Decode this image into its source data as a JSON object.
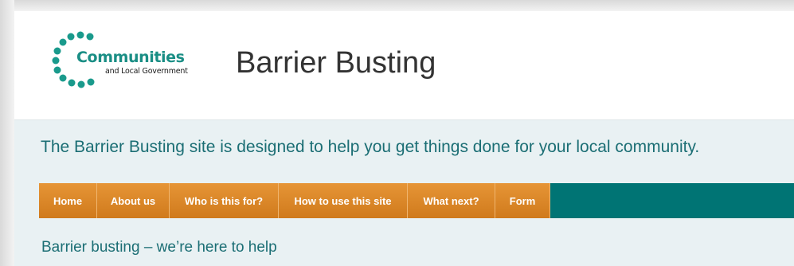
{
  "header": {
    "logo_word": "Communities",
    "logo_subtext": "and Local Government",
    "site_title": "Barrier Busting"
  },
  "main": {
    "intro": "The Barrier Busting site is designed to help you get things done for your local community.",
    "subheading": "Barrier busting – we’re here to help"
  },
  "nav": {
    "items": [
      {
        "label": "Home"
      },
      {
        "label": "About us"
      },
      {
        "label": "Who is this for?"
      },
      {
        "label": "How to use this site"
      },
      {
        "label": "What next?"
      },
      {
        "label": "Form"
      }
    ]
  },
  "colors": {
    "brand_teal": "#1a8e85",
    "nav_orange": "#e08a2c",
    "nav_bar_teal": "#007474",
    "intro_text": "#1b6e74",
    "content_bg": "#e9f1f3"
  },
  "icons": {
    "logo": "dot-ring-logo-icon"
  }
}
